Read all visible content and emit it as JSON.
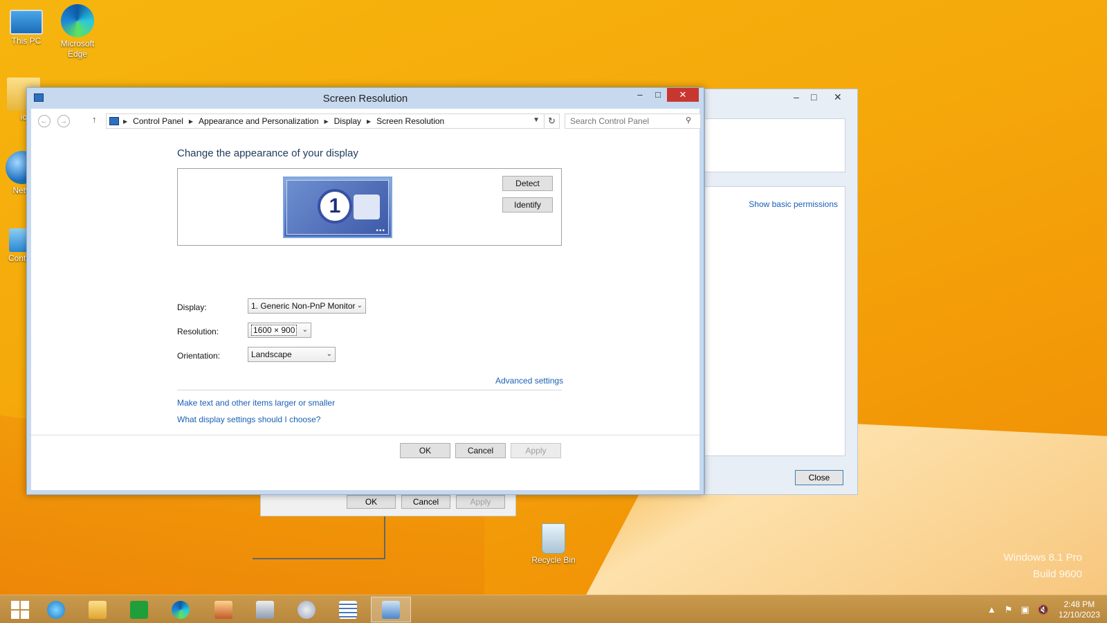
{
  "desktop": {
    "icons": [
      {
        "label": "This PC"
      },
      {
        "label": "Microsoft Edge"
      },
      {
        "label": "ic"
      },
      {
        "label": "Netw"
      },
      {
        "label": "Contro"
      },
      {
        "label": "Recycle Bin"
      }
    ],
    "watermark": {
      "line1": "Windows 8.1 Pro",
      "line2": "Build 9600"
    }
  },
  "bg_window": {
    "link": "Show basic permissions",
    "close_label": "Close"
  },
  "lower_dialog": {
    "ok": "OK",
    "cancel": "Cancel",
    "apply": "Apply"
  },
  "window": {
    "title": "Screen Resolution",
    "breadcrumb": [
      "Control Panel",
      "Appearance and Personalization",
      "Display",
      "Screen Resolution"
    ],
    "search_placeholder": "Search Control Panel",
    "heading": "Change the appearance of your display",
    "monitor_number": "1",
    "detect_label": "Detect",
    "identify_label": "Identify",
    "display_label": "Display:",
    "display_value": "1. Generic Non-PnP Monitor",
    "resolution_label": "Resolution:",
    "resolution_value": "1600 × 900",
    "orientation_label": "Orientation:",
    "orientation_value": "Landscape",
    "advanced_link": "Advanced settings",
    "link_text_size": "Make text and other items larger or smaller",
    "link_which_settings": "What display settings should I choose?",
    "ok_label": "OK",
    "cancel_label": "Cancel",
    "apply_label": "Apply"
  },
  "taskbar": {
    "time": "2:48 PM",
    "date": "12/10/2023"
  },
  "colors": {
    "link": "#1a5fb4",
    "close_button": "#c7372f",
    "desktop": "#f5a70a"
  }
}
